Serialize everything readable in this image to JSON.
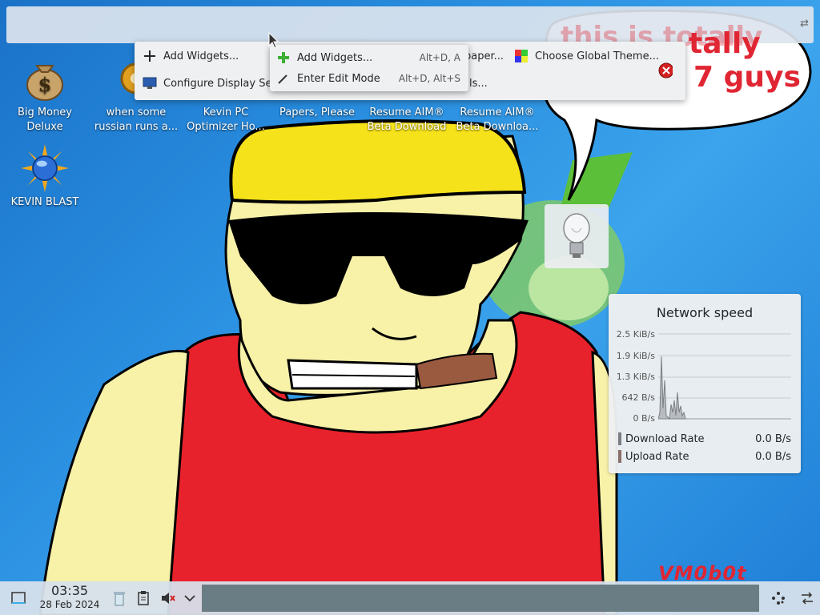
{
  "desktop_icons": [
    {
      "label": "Big Money\nDeluxe",
      "icon": "money-bag-icon"
    },
    {
      "label": "when some\nrussian runs a...",
      "icon": "gear-icon"
    },
    {
      "label": "Kevin PC\nOptimizer Ho...",
      "icon": "app-icon"
    },
    {
      "label": "Papers, Please",
      "icon": "app-icon"
    },
    {
      "label": "Resume AIM®\nBeta Download",
      "icon": "app-icon"
    },
    {
      "label": "Resume AIM®\nBeta Downloa...",
      "icon": "app-icon"
    },
    {
      "label": "KEVIN BLAST",
      "icon": "sun-globe-icon"
    }
  ],
  "context_menu": {
    "add_widgets": "Add Widgets...",
    "configure_display": "Configure Display Setti",
    "wallpaper": "paper...",
    "global_theme": "Choose Global Theme...",
    "partial_item": "ls..."
  },
  "submenu": {
    "items": [
      {
        "label": "Add Widgets...",
        "shortcut": "Alt+D, A"
      },
      {
        "label": "Enter Edit Mode",
        "shortcut": "Alt+D, Alt+S"
      }
    ]
  },
  "speech_bubble": {
    "line1": "this is totally",
    "line2": "7 guys"
  },
  "network_widget": {
    "title": "Network speed",
    "y_labels": [
      "2.5 KiB/s",
      "1.9 KiB/s",
      "1.3 KiB/s",
      "642 B/s",
      "0 B/s"
    ],
    "legend": [
      {
        "name": "Download Rate",
        "value": "0.0 B/s",
        "color": "#7a7f84"
      },
      {
        "name": "Upload Rate",
        "value": "0.0 B/s",
        "color": "#8a6f68"
      }
    ]
  },
  "watermark": "VM0b0t",
  "taskbar": {
    "time": "03:35",
    "date": "28 Feb 2024"
  },
  "colors": {
    "accent": "#3daee9",
    "speech_red": "#e02633"
  }
}
